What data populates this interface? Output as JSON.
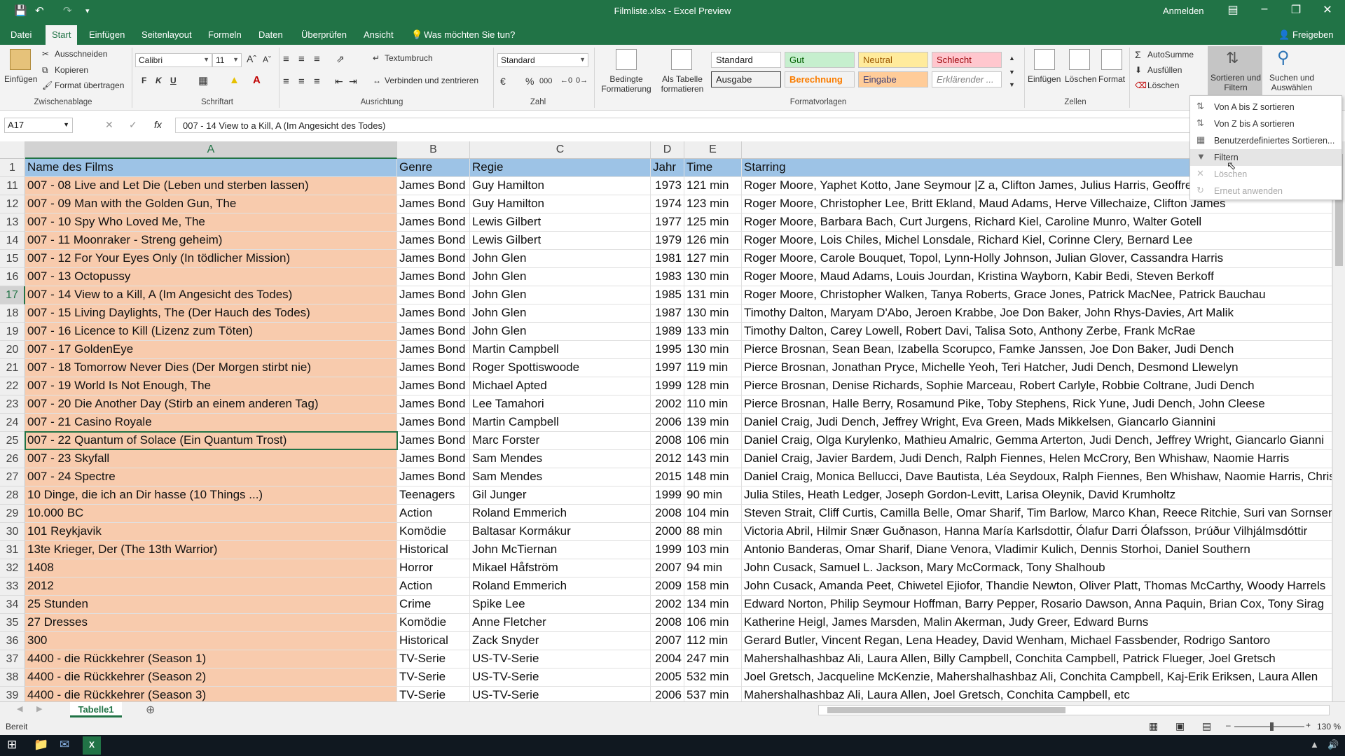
{
  "window": {
    "title": "Filmliste.xlsx  -  Excel Preview",
    "signin": "Anmelden",
    "share": "Freigeben",
    "tell_me": "Was möchten Sie tun?"
  },
  "tabs": [
    "Datei",
    "Start",
    "Einfügen",
    "Seitenlayout",
    "Formeln",
    "Daten",
    "Überprüfen",
    "Ansicht"
  ],
  "ribbon": {
    "clipboard": {
      "paste": "Einfügen",
      "cut": "Ausschneiden",
      "copy": "Kopieren",
      "format_painter": "Format übertragen",
      "label": "Zwischenablage"
    },
    "font": {
      "name": "Calibri",
      "size": "11",
      "bold": "F",
      "italic": "K",
      "underline": "U",
      "label": "Schriftart"
    },
    "alignment": {
      "wrap": "Textumbruch",
      "merge": "Verbinden und zentrieren",
      "label": "Ausrichtung"
    },
    "number": {
      "format": "Standard",
      "percent": "%",
      "thousands": "000",
      "label": "Zahl"
    },
    "styles": {
      "conditional": "Bedingte Formatierung",
      "as_table": "Als Tabelle formatieren",
      "standard": "Standard",
      "gut": "Gut",
      "neutral": "Neutral",
      "schlecht": "Schlecht",
      "ausgabe": "Ausgabe",
      "berechnung": "Berechnung",
      "eingabe": "Eingabe",
      "erklaerend": "Erklärender ...",
      "label": "Formatvorlagen"
    },
    "cells": {
      "insert": "Einfügen",
      "delete": "Löschen",
      "format": "Format",
      "label": "Zellen"
    },
    "editing": {
      "autosum": "AutoSumme",
      "fill": "Ausfüllen",
      "clear": "Löschen",
      "sort_filter": "Sortieren und Filtern",
      "find": "Suchen und Auswählen"
    }
  },
  "formula_bar": {
    "cell_ref": "A17",
    "content": "007 - 14 View to a Kill, A (Im Angesicht des Todes)"
  },
  "columns": [
    "A",
    "B",
    "C",
    "D",
    "E"
  ],
  "header_row": {
    "num": "1",
    "a": "Name des Films",
    "b": "Genre",
    "c": "Regie",
    "d": "Jahr",
    "e": "Time",
    "f": "Starring"
  },
  "rows": [
    {
      "num": "11",
      "a": "007 - 08 Live and Let Die (Leben und sterben lassen)",
      "b": "James Bond",
      "c": "Guy Hamilton",
      "d": "1973",
      "e": "121 min",
      "f": "Roger Moore, Yaphet Kotto, Jane Seymour |Z a, Clifton James, Julius Harris, Geoffrey"
    },
    {
      "num": "12",
      "a": "007 - 09 Man with the Golden Gun, The",
      "b": "James Bond",
      "c": "Guy Hamilton",
      "d": "1974",
      "e": "123 min",
      "f": "Roger Moore, Christopher Lee, Britt Ekland, Maud Adams, Herve Villechaize, Clifton James"
    },
    {
      "num": "13",
      "a": "007 - 10 Spy Who Loved Me, The",
      "b": "James Bond",
      "c": "Lewis Gilbert",
      "d": "1977",
      "e": "125 min",
      "f": "Roger Moore, Barbara Bach, Curt Jurgens, Richard Kiel, Caroline Munro, Walter Gotell"
    },
    {
      "num": "14",
      "a": "007 - 11 Moonraker - Streng geheim)",
      "b": "James Bond",
      "c": "Lewis Gilbert",
      "d": "1979",
      "e": "126 min",
      "f": "Roger Moore, Lois Chiles, Michel Lonsdale, Richard Kiel, Corinne Clery, Bernard Lee"
    },
    {
      "num": "15",
      "a": "007 - 12 For Your Eyes Only (In tödlicher Mission)",
      "b": "James Bond",
      "c": "John Glen",
      "d": "1981",
      "e": "127 min",
      "f": "Roger Moore, Carole Bouquet, Topol, Lynn-Holly Johnson, Julian Glover, Cassandra Harris"
    },
    {
      "num": "16",
      "a": "007 - 13 Octopussy",
      "b": "James Bond",
      "c": "John Glen",
      "d": "1983",
      "e": "130 min",
      "f": "Roger Moore, Maud Adams, Louis Jourdan, Kristina Wayborn, Kabir Bedi, Steven Berkoff"
    },
    {
      "num": "17",
      "a": "007 - 14 View to a Kill, A (Im Angesicht des Todes)",
      "b": "James Bond",
      "c": "John Glen",
      "d": "1985",
      "e": "131 min",
      "f": "Roger Moore, Christopher Walken, Tanya Roberts, Grace Jones, Patrick MacNee, Patrick Bauchau"
    },
    {
      "num": "18",
      "a": "007 - 15 Living Daylights, The (Der Hauch des Todes)",
      "b": "James Bond",
      "c": "John Glen",
      "d": "1987",
      "e": "130 min",
      "f": "Timothy Dalton, Maryam D'Abo, Jeroen Krabbe, Joe Don Baker, John Rhys-Davies, Art Malik"
    },
    {
      "num": "19",
      "a": "007 - 16 Licence to Kill (Lizenz zum Töten)",
      "b": "James Bond",
      "c": "John Glen",
      "d": "1989",
      "e": "133 min",
      "f": "Timothy Dalton, Carey Lowell, Robert Davi, Talisa Soto, Anthony Zerbe, Frank McRae"
    },
    {
      "num": "20",
      "a": "007 - 17 GoldenEye",
      "b": "James Bond",
      "c": "Martin Campbell",
      "d": "1995",
      "e": "130 min",
      "f": "Pierce Brosnan, Sean Bean, Izabella Scorupco, Famke Janssen, Joe Don Baker, Judi Dench"
    },
    {
      "num": "21",
      "a": "007 - 18 Tomorrow Never Dies (Der Morgen stirbt nie)",
      "b": "James Bond",
      "c": "Roger Spottiswoode",
      "d": "1997",
      "e": "119 min",
      "f": "Pierce Brosnan, Jonathan Pryce, Michelle Yeoh, Teri Hatcher, Judi Dench, Desmond Llewelyn"
    },
    {
      "num": "22",
      "a": "007 - 19 World Is Not Enough, The",
      "b": "James Bond",
      "c": "Michael Apted",
      "d": "1999",
      "e": "128 min",
      "f": "Pierce Brosnan, Denise Richards, Sophie Marceau, Robert Carlyle, Robbie Coltrane, Judi Dench"
    },
    {
      "num": "23",
      "a": "007 - 20 Die Another Day (Stirb an einem anderen Tag)",
      "b": "James Bond",
      "c": "Lee Tamahori",
      "d": "2002",
      "e": "110 min",
      "f": "Pierce Brosnan, Halle Berry, Rosamund Pike, Toby Stephens, Rick Yune, Judi Dench, John Cleese"
    },
    {
      "num": "24",
      "a": "007 - 21 Casino Royale",
      "b": "James Bond",
      "c": "Martin Campbell",
      "d": "2006",
      "e": "139 min",
      "f": "Daniel Craig, Judi Dench, Jeffrey Wright, Eva Green, Mads Mikkelsen, Giancarlo Giannini"
    },
    {
      "num": "25",
      "a": "007 - 22 Quantum of Solace (Ein Quantum Trost)",
      "b": "James Bond",
      "c": "Marc Forster",
      "d": "2008",
      "e": "106 min",
      "f": "Daniel Craig, Olga Kurylenko, Mathieu Amalric, Gemma Arterton, Judi Dench, Jeffrey Wright, Giancarlo Gianni"
    },
    {
      "num": "26",
      "a": "007 - 23 Skyfall",
      "b": "James Bond",
      "c": "Sam Mendes",
      "d": "2012",
      "e": "143 min",
      "f": "Daniel Craig, Javier Bardem, Judi Dench, Ralph Fiennes, Helen McCrory, Ben Whishaw, Naomie Harris"
    },
    {
      "num": "27",
      "a": "007 - 24 Spectre",
      "b": "James Bond",
      "c": "Sam Mendes",
      "d": "2015",
      "e": "148 min",
      "f": "Daniel Craig, Monica Bellucci, Dave Bautista, Léa Seydoux, Ralph Fiennes, Ben Whishaw, Naomie Harris, Christ"
    },
    {
      "num": "28",
      "a": "10 Dinge, die ich an Dir hasse (10 Things ...)",
      "b": "Teenagers",
      "c": "Gil Junger",
      "d": "1999",
      "e": "90 min",
      "f": "Julia Stiles, Heath Ledger, Joseph Gordon-Levitt, Larisa Oleynik, David Krumholtz"
    },
    {
      "num": "29",
      "a": "10.000 BC",
      "b": "Action",
      "c": "Roland Emmerich",
      "d": "2008",
      "e": "104 min",
      "f": "Steven Strait, Cliff Curtis, Camilla Belle, Omar Sharif, Tim Barlow, Marco Khan, Reece Ritchie, Suri van Sornsen"
    },
    {
      "num": "30",
      "a": "101 Reykjavik",
      "b": "Komödie",
      "c": "Baltasar Kormákur",
      "d": "2000",
      "e": "88 min",
      "f": "Victoria Abril, Hilmir Snær Guðnason, Hanna María Karlsdottir, Ólafur Darri Ólafsson, Þrúður Vilhjálmsdóttir"
    },
    {
      "num": "31",
      "a": "13te Krieger, Der (The 13th Warrior)",
      "b": "Historical",
      "c": "John McTiernan",
      "d": "1999",
      "e": "103 min",
      "f": "Antonio Banderas, Omar Sharif, Diane Venora, Vladimir Kulich, Dennis Storhoi, Daniel Southern"
    },
    {
      "num": "32",
      "a": "1408",
      "b": "Horror",
      "c": "Mikael Håfström",
      "d": "2007",
      "e": "94 min",
      "f": "John Cusack, Samuel L. Jackson, Mary McCormack, Tony Shalhoub"
    },
    {
      "num": "33",
      "a": "2012",
      "b": "Action",
      "c": "Roland Emmerich",
      "d": "2009",
      "e": "158 min",
      "f": "John Cusack, Amanda Peet, Chiwetel Ejiofor, Thandie Newton, Oliver Platt, Thomas McCarthy, Woody Harrels"
    },
    {
      "num": "34",
      "a": "25 Stunden",
      "b": "Crime",
      "c": "Spike Lee",
      "d": "2002",
      "e": "134 min",
      "f": "Edward Norton, Philip Seymour Hoffman, Barry Pepper, Rosario Dawson, Anna Paquin, Brian Cox, Tony Sirag"
    },
    {
      "num": "35",
      "a": "27 Dresses",
      "b": "Komödie",
      "c": "Anne Fletcher",
      "d": "2008",
      "e": "106 min",
      "f": "Katherine Heigl, James Marsden, Malin Akerman, Judy Greer, Edward Burns"
    },
    {
      "num": "36",
      "a": "300",
      "b": "Historical",
      "c": "Zack Snyder",
      "d": "2007",
      "e": "112 min",
      "f": "Gerard Butler, Vincent Regan, Lena Headey, David Wenham, Michael Fassbender, Rodrigo Santoro"
    },
    {
      "num": "37",
      "a": "4400 - die Rückkehrer (Season 1)",
      "b": "TV-Serie",
      "c": "US-TV-Serie",
      "d": "2004",
      "e": "247 min",
      "f": "Mahershalhashbaz Ali, Laura Allen, Billy Campbell, Conchita Campbell, Patrick Flueger, Joel Gretsch"
    },
    {
      "num": "38",
      "a": "4400 - die Rückkehrer (Season 2)",
      "b": "TV-Serie",
      "c": "US-TV-Serie",
      "d": "2005",
      "e": "532 min",
      "f": "Joel Gretsch, Jacqueline McKenzie, Mahershalhashbaz Ali, Conchita Campbell, Kaj-Erik Eriksen, Laura Allen"
    },
    {
      "num": "39",
      "a": "4400 - die Rückkehrer (Season 3)",
      "b": "TV-Serie",
      "c": "US-TV-Serie",
      "d": "2006",
      "e": "537 min",
      "f": "Mahershalhashbaz Ali, Laura Allen, Joel Gretsch, Conchita Campbell, etc"
    }
  ],
  "sort_menu": {
    "items": [
      {
        "label": "Von A bis Z sortieren",
        "icon": "sort-az-icon",
        "enabled": true
      },
      {
        "label": "Von Z bis A sortieren",
        "icon": "sort-za-icon",
        "enabled": true
      },
      {
        "label": "Benutzerdefiniertes Sortieren...",
        "icon": "custom-sort-icon",
        "enabled": true
      },
      {
        "label": "Filtern",
        "icon": "filter-icon",
        "enabled": true
      },
      {
        "label": "Löschen",
        "icon": "clear-filter-icon",
        "enabled": false
      },
      {
        "label": "Erneut anwenden",
        "icon": "reapply-icon",
        "enabled": false
      }
    ]
  },
  "sheet": {
    "tab": "Tabelle1"
  },
  "status": {
    "ready": "Bereit",
    "zoom": "130 %"
  },
  "colors": {
    "accent": "#217346",
    "name_fill": "#f8cbad",
    "header_fill": "#9dc3e6"
  }
}
